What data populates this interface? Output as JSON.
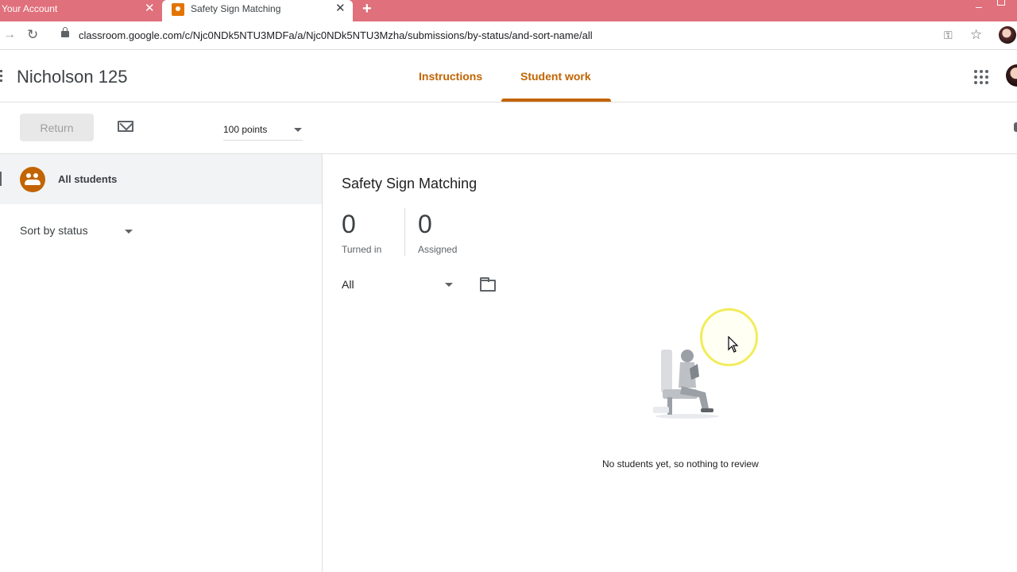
{
  "browser": {
    "tabs": [
      {
        "title": "Your Account",
        "close": "✕"
      },
      {
        "title": "Safety Sign Matching",
        "close": "✕"
      }
    ],
    "new_tab": "+",
    "url": "classroom.google.com/c/Njc0NDk5NTU3MDFa/a/Njc0NDk5NTU3Mzha/submissions/by-status/and-sort-name/all"
  },
  "header": {
    "class_name": "Nicholson 125",
    "tabs": [
      {
        "label": "Instructions"
      },
      {
        "label": "Student work"
      }
    ],
    "active_tab": "Student work"
  },
  "toolbar": {
    "return_label": "Return",
    "points_value": "100 points"
  },
  "sidebar": {
    "all_students_label": "All students",
    "sort_label": "Sort by status"
  },
  "main": {
    "assignment_title": "Safety Sign Matching",
    "stats": [
      {
        "value": "0",
        "label": "Turned in"
      },
      {
        "value": "0",
        "label": "Assigned"
      }
    ],
    "filter_value": "All",
    "empty_message": "No students yet, so nothing to review"
  },
  "colors": {
    "accent": "#c26401",
    "tabstrip": "#e0707b"
  }
}
